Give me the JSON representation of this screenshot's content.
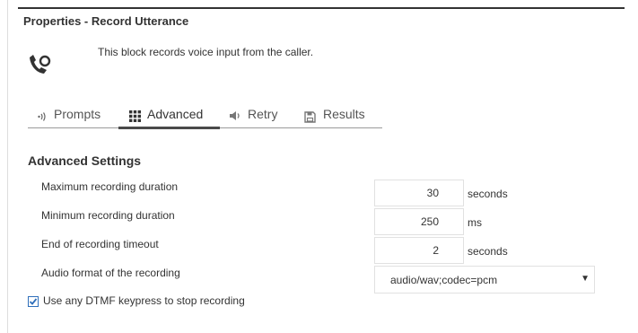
{
  "panel": {
    "title": "Properties - Record Utterance"
  },
  "block": {
    "icon": "phone-record-icon",
    "description": "This block records voice input from the caller."
  },
  "tabs": [
    {
      "label": "Prompts",
      "icon": "sound-wave-icon",
      "active": false
    },
    {
      "label": "Advanced",
      "icon": "grid-icon",
      "active": true
    },
    {
      "label": "Retry",
      "icon": "speaker-icon",
      "active": false
    },
    {
      "label": "Results",
      "icon": "save-icon",
      "active": false
    }
  ],
  "advanced": {
    "section_title": "Advanced Settings",
    "max_duration": {
      "label": "Maximum recording duration",
      "value": "30",
      "unit": "seconds"
    },
    "min_duration": {
      "label": "Minimum recording duration",
      "value": "250",
      "unit": "ms"
    },
    "end_timeout": {
      "label": "End of recording timeout",
      "value": "2",
      "unit": "seconds"
    },
    "audio_format": {
      "label": "Audio format of the recording",
      "value": "audio/wav;codec=pcm",
      "caret": "▼"
    },
    "dtmf": {
      "label": "Use any DTMF keypress to stop recording",
      "checked": true
    }
  },
  "colors": {
    "accent": "#2f6fba",
    "text": "#333333",
    "rule": "#333333",
    "border": "#e1e1e1"
  }
}
